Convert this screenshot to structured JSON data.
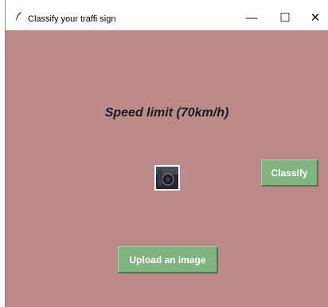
{
  "window": {
    "title": "Classify your traffi sign",
    "controls": {
      "minimize": "—",
      "maximize": "☐",
      "close": "✕"
    },
    "background": "#bc8a89"
  },
  "main": {
    "prediction_text": "Speed limit (70km/h)",
    "image_preview_icon": "uploaded-image-thumbnail",
    "classify_button": "Classify",
    "upload_button": "Upload an image",
    "button_color": "#7fb37f"
  }
}
